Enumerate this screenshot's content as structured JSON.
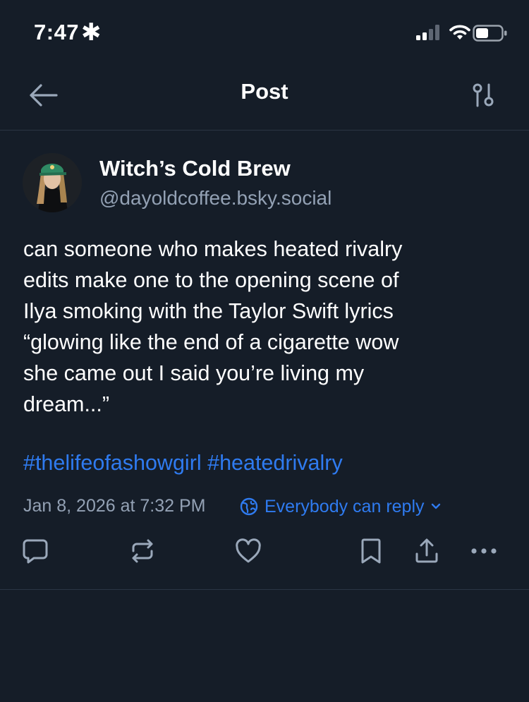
{
  "status_bar": {
    "time": "7:47",
    "extra_symbol": "✱",
    "icons": [
      "signal-icon",
      "wifi-icon",
      "battery-icon"
    ]
  },
  "header": {
    "title": "Post",
    "back_icon": "arrow-left-icon",
    "filter_icon": "sliders-icon"
  },
  "post": {
    "author": {
      "display_name": "Witch’s Cold Brew",
      "handle": "@dayoldcoffee.bsky.social"
    },
    "text_lines": [
      "can someone who makes heated rivalry",
      "edits make one to the opening scene of",
      "Ilya smoking with the Taylor Swift lyrics",
      "“glowing like the end of a cigarette wow",
      "she came out I said you’re living my",
      "dream...”"
    ],
    "hashtags": [
      "#thelifeofashowgirl",
      "#heatedrivalry"
    ],
    "timestamp": "Jan 8, 2026 at 7:32 PM",
    "reply_setting": "Everybody can reply",
    "actions": [
      "reply-icon",
      "repost-icon",
      "like-icon",
      "bookmark-icon",
      "share-icon",
      "more-icon"
    ]
  },
  "colors": {
    "background": "#151d28",
    "text": "#ffffff",
    "muted": "#93a1b4",
    "accent": "#2f7bf0",
    "divider": "#2a3544",
    "icon": "#9aa8ba"
  }
}
